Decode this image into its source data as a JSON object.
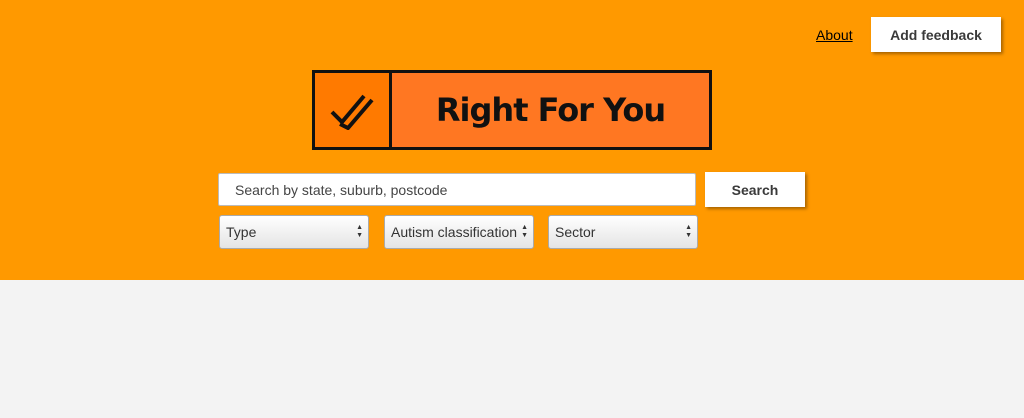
{
  "nav": {
    "about_label": "About",
    "feedback_label": "Add feedback"
  },
  "logo": {
    "text": "Right For You",
    "icon": "double-check-icon"
  },
  "search": {
    "placeholder": "Search by state, suburb, postcode",
    "value": "",
    "button_label": "Search"
  },
  "filters": [
    {
      "label": "Type"
    },
    {
      "label": "Autism classification"
    },
    {
      "label": "Sector"
    }
  ],
  "colors": {
    "header_bg": "#ff9900",
    "logo_bg": "#ff7722",
    "page_bg": "#f3f3f3"
  }
}
